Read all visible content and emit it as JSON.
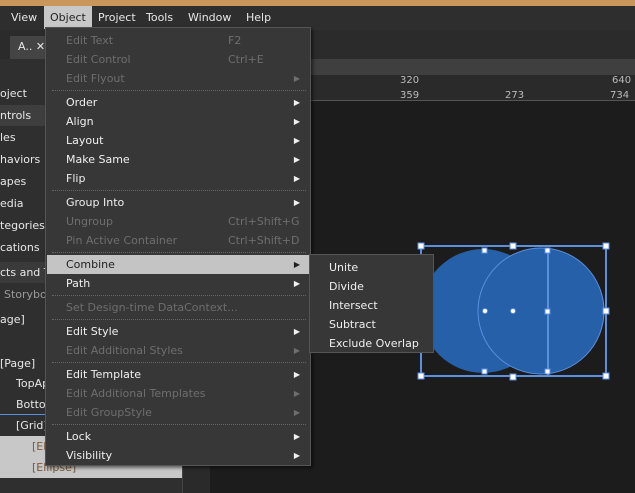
{
  "menubar": {
    "items": [
      "View",
      "Object",
      "Project",
      "Tools",
      "Window",
      "Help"
    ],
    "active": "Object"
  },
  "tab": {
    "label": "A..",
    "close": "✕"
  },
  "left_panel": {
    "items": [
      "oject",
      "ntrols",
      "les",
      "haviors",
      "apes",
      "edia",
      "tegories",
      "cations",
      "cts and T",
      "Storybo",
      "age]",
      "[Page]",
      "TopAp",
      "Botto",
      "[Grid]",
      "[El",
      "[Ellipse]"
    ]
  },
  "ruler": {
    "top": [
      "320",
      "640"
    ],
    "bottom": [
      "359",
      "273",
      "734"
    ]
  },
  "object_menu": {
    "edit_text": "Edit Text",
    "edit_text_sc": "F2",
    "edit_control": "Edit Control",
    "edit_control_sc": "Ctrl+E",
    "edit_flyout": "Edit Flyout",
    "order": "Order",
    "align": "Align",
    "layout": "Layout",
    "make_same": "Make Same",
    "flip": "Flip",
    "group_into": "Group Into",
    "ungroup": "Ungroup",
    "ungroup_sc": "Ctrl+Shift+G",
    "pin": "Pin Active Container",
    "pin_sc": "Ctrl+Shift+D",
    "combine": "Combine",
    "path": "Path",
    "datacontext": "Set Design-time DataContext...",
    "edit_style": "Edit Style",
    "edit_additional_styles": "Edit Additional Styles",
    "edit_template": "Edit Template",
    "edit_additional_templates": "Edit Additional Templates",
    "edit_groupstyle": "Edit GroupStyle",
    "lock": "Lock",
    "visibility": "Visibility",
    "arrow": "▶"
  },
  "combine_submenu": {
    "items": [
      "Unite",
      "Divide",
      "Intersect",
      "Subtract",
      "Exclude Overlap"
    ]
  },
  "colors": {
    "accent": "#c9975c",
    "shape_fill": "#2560a8",
    "selection": "#5b8fe0"
  }
}
